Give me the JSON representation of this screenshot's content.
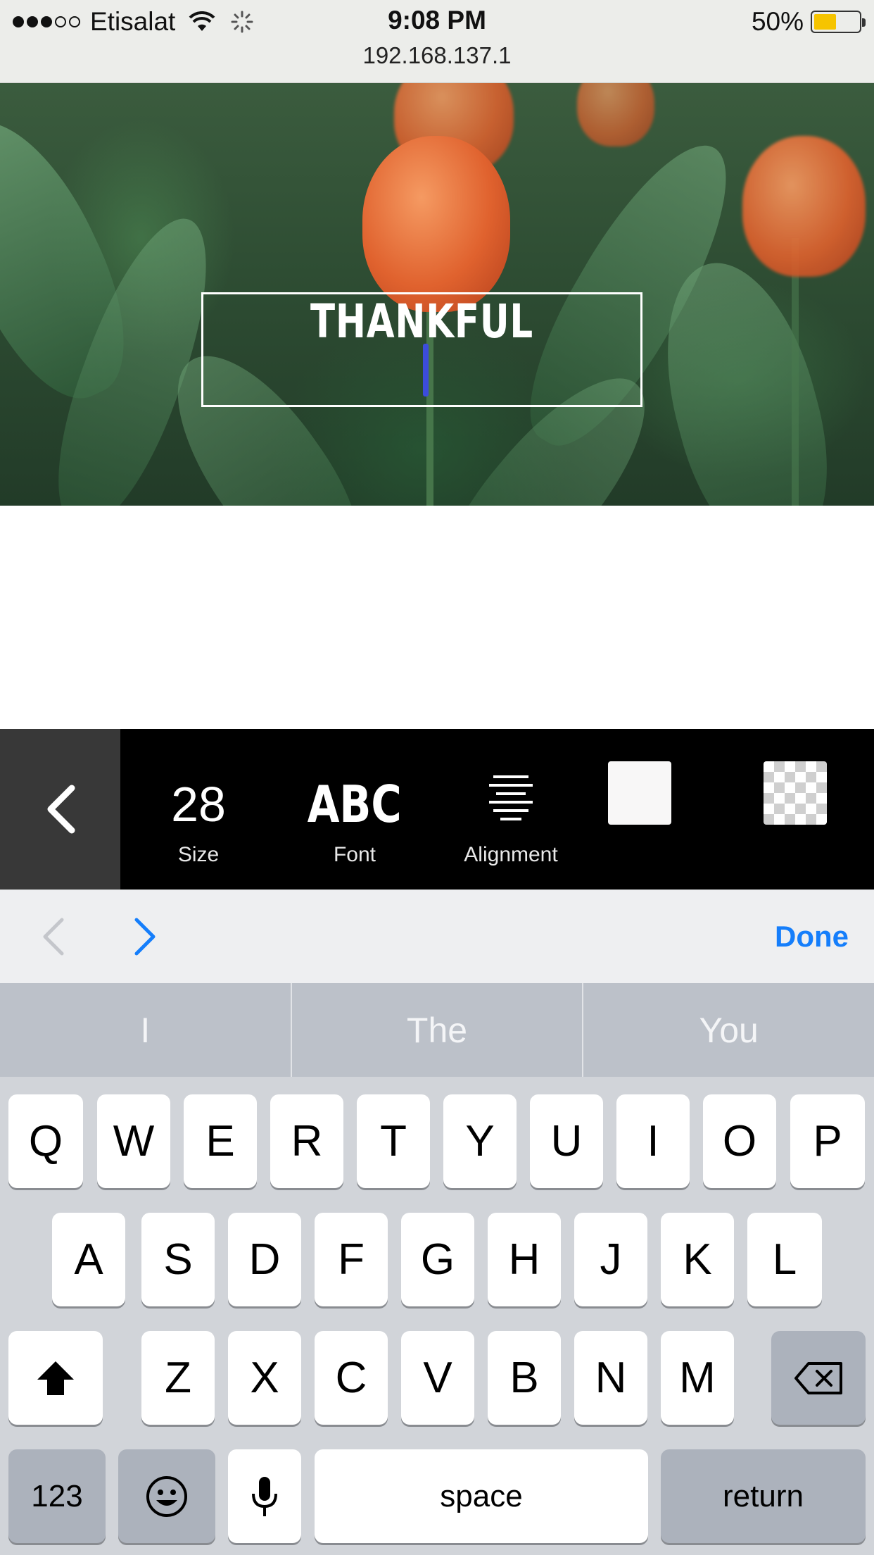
{
  "status_bar": {
    "carrier": "Etisalat",
    "time": "9:08 PM",
    "url": "192.168.137.1",
    "battery_percent": "50%",
    "battery_level": 0.5,
    "signal_bars_filled": 3,
    "signal_bars_total": 5
  },
  "canvas": {
    "text": "THANKFUL",
    "text_color": "#ffffff",
    "cursor_color": "#3c4cdb"
  },
  "toolbar": {
    "back_icon": "chevron-left-icon",
    "size_value": "28",
    "size_label": "Size",
    "font_sample": "ABC",
    "font_label": "Font",
    "alignment_label": "Alignment",
    "text_color_swatch": "#f8f7f7",
    "background_swatch": "transparent"
  },
  "accessory": {
    "done_label": "Done",
    "done_color": "#157efb"
  },
  "keyboard": {
    "predictions": [
      "I",
      "The",
      "You"
    ],
    "row1": [
      "Q",
      "W",
      "E",
      "R",
      "T",
      "Y",
      "U",
      "I",
      "O",
      "P"
    ],
    "row2": [
      "A",
      "S",
      "D",
      "F",
      "G",
      "H",
      "J",
      "K",
      "L"
    ],
    "row3": [
      "Z",
      "X",
      "C",
      "V",
      "B",
      "N",
      "M"
    ],
    "numbers_label": "123",
    "space_label": "space",
    "return_label": "return"
  }
}
